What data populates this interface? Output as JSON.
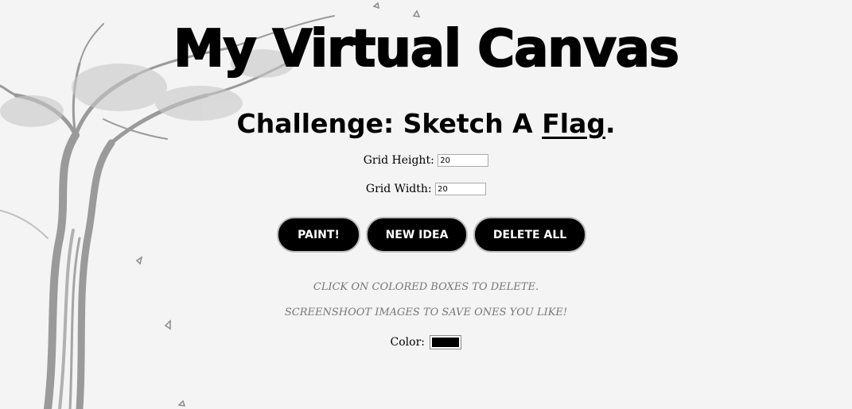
{
  "title": "My Virtual Canvas",
  "challenge": {
    "prefix": "Challenge: Sketch A ",
    "idea": "Flag",
    "suffix": "."
  },
  "grid": {
    "height_label": "Grid Height:",
    "height_value": "20",
    "width_label": "Grid Width:",
    "width_value": "20"
  },
  "buttons": {
    "paint": "PAINT!",
    "new_idea": "NEW IDEA",
    "delete_all": "DELETE ALL"
  },
  "notes": {
    "delete_hint": "CLICK ON COLORED BOXES TO DELETE.",
    "save_hint": "SCREENSHOOT IMAGES TO SAVE ONES YOU LIKE!"
  },
  "color": {
    "label": "Color:",
    "value": "#000000"
  },
  "colors": {
    "button_bg": "#000000",
    "button_text": "#ffffff",
    "note_text": "#777777"
  },
  "icons": {
    "background": "tree-sketch"
  }
}
